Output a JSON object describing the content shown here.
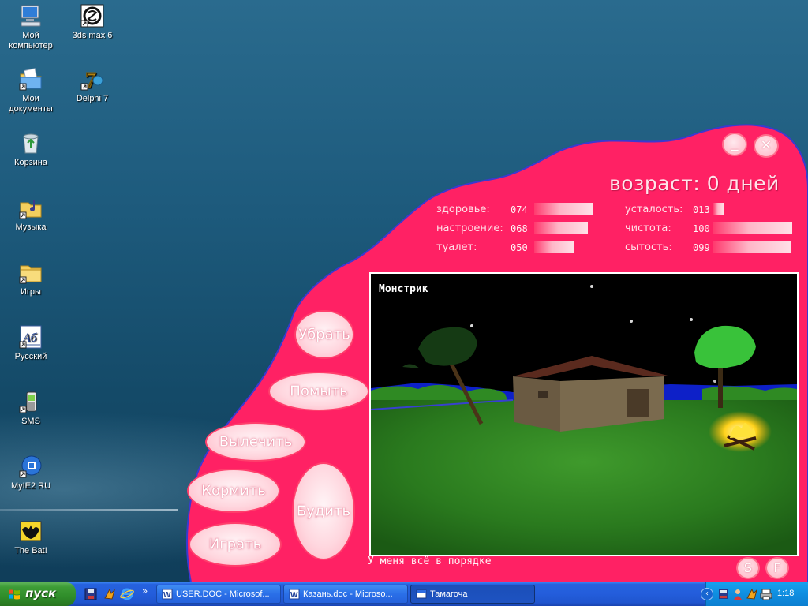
{
  "desktop": {
    "icons": [
      {
        "label": "Мой компьютер",
        "icon": "computer-icon"
      },
      {
        "label": "3ds max 6",
        "icon": "3dsmax-icon"
      },
      {
        "label": "Мои документы",
        "icon": "documents-icon"
      },
      {
        "label": "Delphi 7",
        "icon": "delphi-icon"
      },
      {
        "label": "Корзина",
        "icon": "recycle-bin-icon"
      },
      {
        "label": "Музыка",
        "icon": "music-folder-icon"
      },
      {
        "label": "Игры",
        "icon": "folder-icon"
      },
      {
        "label": "Русский",
        "icon": "russian-keyboard-icon"
      },
      {
        "label": "SMS",
        "icon": "sms-phone-icon"
      },
      {
        "label": "MyIE2 RU",
        "icon": "myie2-icon"
      },
      {
        "label": "The Bat!",
        "icon": "the-bat-icon"
      }
    ]
  },
  "tamagochi": {
    "age_text": "возраст: 0 дней",
    "stats": [
      {
        "label": "здоровье:",
        "value": "074",
        "level": 0.74
      },
      {
        "label": "настроение:",
        "value": "068",
        "level": 0.68
      },
      {
        "label": "туалет:",
        "value": "050",
        "level": 0.5
      },
      {
        "label": "усталость:",
        "value": "013",
        "level": 0.13
      },
      {
        "label": "чистота:",
        "value": "100",
        "level": 1.0
      },
      {
        "label": "сытость:",
        "value": "099",
        "level": 0.99
      }
    ],
    "pet_name": "Монстрик",
    "status_message": "У меня всё в порядке",
    "actions": {
      "clean": "Убрать",
      "wash": "Помыть",
      "heal": "Вылечить",
      "feed": "Кормить",
      "wake": "Будить",
      "play": "Играть"
    },
    "window_buttons": {
      "minimize": "_",
      "close": "×"
    },
    "bottom_buttons": {
      "sound": "S",
      "fullscreen": "F"
    },
    "colors": {
      "body": "#ff2164",
      "border": "#3a3ad0",
      "button_border": "#ff3f6c"
    }
  },
  "taskbar": {
    "start_label": "пуск",
    "tasks": [
      {
        "label": "USER.DOC - Microsof...",
        "icon": "word-doc-icon"
      },
      {
        "label": "Казань.doc - Microso...",
        "icon": "word-doc-icon"
      },
      {
        "label": "Тамагоча",
        "icon": "window-icon"
      }
    ],
    "clock": "1:18",
    "expand_symbol": "»"
  }
}
